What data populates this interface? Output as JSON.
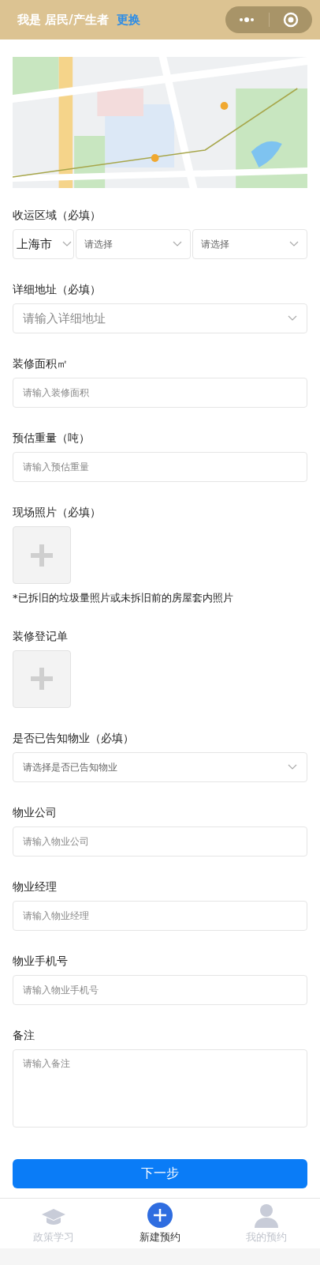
{
  "header": {
    "title": "我是 居民/产生者",
    "change_link": "更换"
  },
  "form": [
    {
      "kind": "region",
      "label": "收运区域（必填）",
      "selects": [
        {
          "value": "上海市",
          "selected": true
        },
        {
          "value": "请选择",
          "selected": false
        },
        {
          "value": "请选择",
          "selected": false
        }
      ]
    },
    {
      "kind": "select",
      "label": "详细地址（必填）",
      "placeholder": "请输入详细地址",
      "large": true
    },
    {
      "kind": "input",
      "label": "装修面积㎡",
      "placeholder": "请输入装修面积"
    },
    {
      "kind": "input",
      "label": "预估重量（吨）",
      "placeholder": "请输入预估重量"
    },
    {
      "kind": "upload",
      "label": "现场照片（必填）",
      "note": "*已拆旧的垃圾量照片或未拆旧前的房屋套内照片"
    },
    {
      "kind": "upload",
      "label": "装修登记单"
    },
    {
      "kind": "select",
      "label": "是否已告知物业（必填）",
      "placeholder": "请选择是否已告知物业",
      "large": false
    },
    {
      "kind": "input",
      "label": "物业公司",
      "placeholder": "请输入物业公司"
    },
    {
      "kind": "input",
      "label": "物业经理",
      "placeholder": "请输入物业经理"
    },
    {
      "kind": "input",
      "label": "物业手机号",
      "placeholder": "请输入物业手机号"
    },
    {
      "kind": "textarea",
      "label": "备注",
      "placeholder": "请输入备注"
    }
  ],
  "next_button": "下一步",
  "tabs": [
    {
      "label": "政策学习",
      "selected": false
    },
    {
      "label": "新建预约",
      "selected": true
    },
    {
      "label": "我的预约",
      "selected": false
    }
  ]
}
